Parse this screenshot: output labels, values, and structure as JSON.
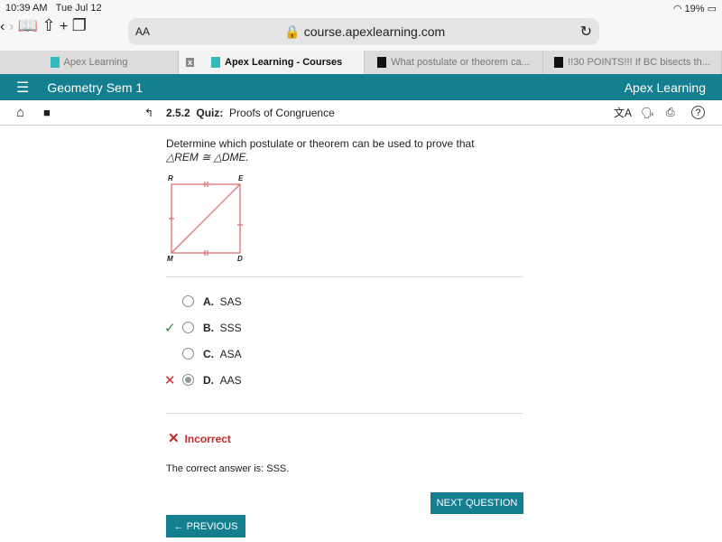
{
  "status": {
    "time": "10:39 AM",
    "date": "Tue Jul 12",
    "battery": "19%"
  },
  "browser": {
    "aa": "AA",
    "url": "course.apexlearning.com"
  },
  "tabs": [
    {
      "label": "Apex Learning"
    },
    {
      "label": "Apex Learning - Courses",
      "close": "x"
    },
    {
      "label": "What postulate or theorem ca..."
    },
    {
      "label": "!!30 POINTS!!! If BC bisects th..."
    }
  ],
  "header": {
    "title": "Geometry Sem 1",
    "logo": "Apex Learning"
  },
  "toolbar": {
    "section": "2.5.2",
    "quiz_label": "Quiz:",
    "quiz_title": "Proofs of Congruence"
  },
  "question": {
    "text": "Determine which postulate or theorem can be used to prove that",
    "statement": "△REM ≅ △DME.",
    "labels": {
      "r": "R",
      "e": "E",
      "m": "M",
      "d": "D"
    }
  },
  "options": [
    {
      "letter": "A.",
      "text": "SAS",
      "mark": ""
    },
    {
      "letter": "B.",
      "text": "SSS",
      "mark": "✓"
    },
    {
      "letter": "C.",
      "text": "ASA",
      "mark": ""
    },
    {
      "letter": "D.",
      "text": "AAS",
      "mark": "✕",
      "selected": true
    }
  ],
  "result": {
    "icon": "✕",
    "label": "Incorrect",
    "answer": "The correct answer is: SSS."
  },
  "buttons": {
    "next": "NEXT QUESTION",
    "previous": "← PREVIOUS"
  },
  "colors": {
    "teal": "#147f8f",
    "correct": "#2e8b2e",
    "wrong": "#d32f2f",
    "figure": "#e07070"
  }
}
